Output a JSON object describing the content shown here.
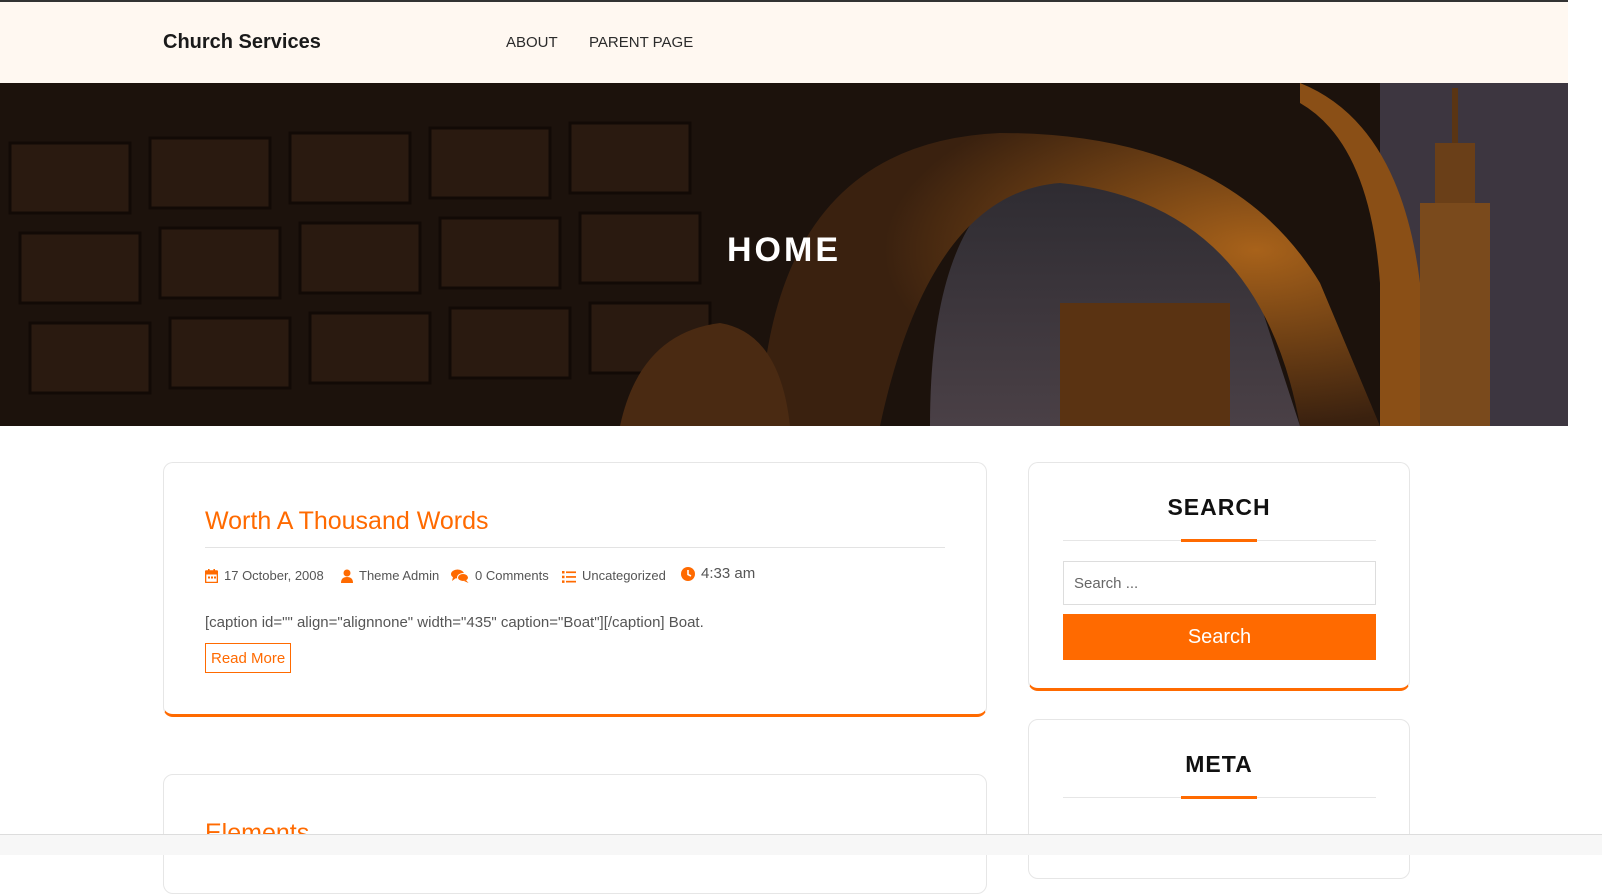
{
  "site": {
    "title": "Church Services"
  },
  "nav": {
    "items": [
      "ABOUT",
      "PARENT PAGE"
    ]
  },
  "hero": {
    "title": "HOME"
  },
  "posts": [
    {
      "title": "Worth A Thousand Words",
      "date": "17 October, 2008",
      "author": "Theme Admin",
      "comments": "0 Comments",
      "category": "Uncategorized",
      "time": "4:33 am",
      "excerpt": "[caption id=\"\" align=\"alignnone\" width=\"435\" caption=\"Boat\"][/caption] Boat.",
      "read_more": "Read More"
    },
    {
      "title": "Elements"
    }
  ],
  "sidebar": {
    "search": {
      "title": "SEARCH",
      "placeholder": "Search ...",
      "button": "Search"
    },
    "meta": {
      "title": "META"
    }
  },
  "colors": {
    "accent": "#ff6a00",
    "header_bg": "#fff8f1"
  },
  "icons": [
    "calendar-icon",
    "user-icon",
    "comments-icon",
    "list-icon",
    "clock-icon"
  ]
}
